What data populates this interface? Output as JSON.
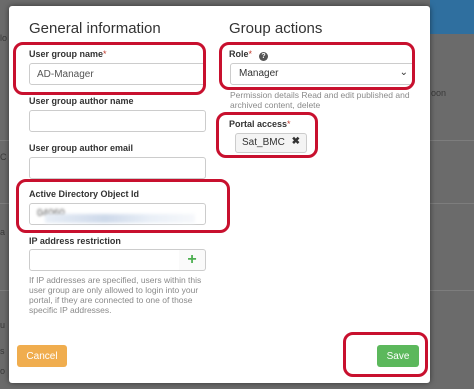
{
  "modal": {
    "left_title": "General information",
    "right_title": "Group actions",
    "fields": {
      "user_group_name": {
        "label": "User group name",
        "required_mark": "*",
        "value": "AD-Manager"
      },
      "author_name": {
        "label": "User group author name",
        "value": ""
      },
      "author_email": {
        "label": "User group author email",
        "value": ""
      },
      "ad_object_id": {
        "label": "Active Directory Object Id",
        "value": "04060"
      },
      "ip_restriction": {
        "label": "IP address restriction",
        "value": "",
        "help": "If IP addresses are specified, users within this user group are only allowed to login into your portal, if they are connected to one of those specific IP addresses."
      }
    },
    "role": {
      "label": "Role",
      "required_mark": "*",
      "value": "Manager",
      "description": "Permission details Read and edit published and archived content, delete"
    },
    "portal_access": {
      "label": "Portal access",
      "required_mark": "*",
      "tag": "Sat_BMC"
    },
    "buttons": {
      "cancel": "Cancel",
      "save": "Save"
    }
  },
  "background": {
    "text_right": "oon",
    "left_fragments": [
      "lo",
      "C",
      "a",
      "u",
      "s",
      "o"
    ]
  },
  "colors": {
    "save": "#5cb85c",
    "cancel": "#f0ad4e",
    "highlight": "#c8102e",
    "plus": "#4caf50"
  },
  "icons": [
    "info-icon",
    "plus-icon",
    "chevron-down-icon",
    "close-icon"
  ]
}
